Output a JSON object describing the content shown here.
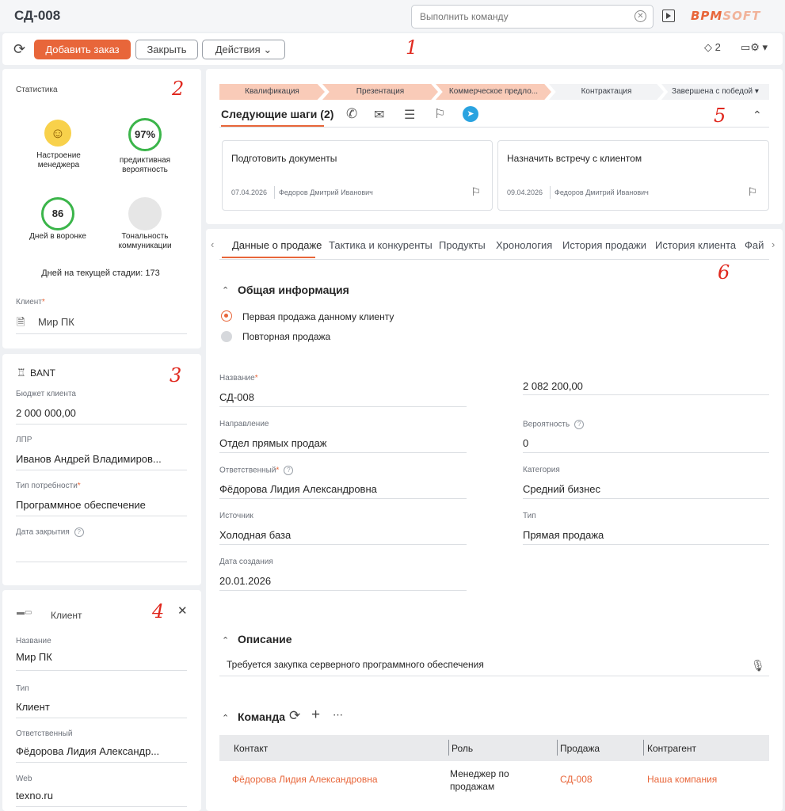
{
  "header": {
    "title": "СД-008",
    "command_placeholder": "Выполнить команду",
    "logo_part1": "BPM",
    "logo_part2": "SOFT"
  },
  "toolbar": {
    "add_label": "Добавить заказ",
    "close_label": "Закрыть",
    "actions_label": "Действия",
    "tag_count": "2"
  },
  "markers": [
    "1",
    "2",
    "3",
    "4",
    "5",
    "6"
  ],
  "stats": {
    "title": "Статистика",
    "mood_label": "Настроение менеджера",
    "probability_value": "97%",
    "probability_label": "предиктивная вероятность",
    "days_value": "86",
    "days_label": "Дней в воронке",
    "tone_label": "Тональность коммуникации",
    "stage_days": "Дней на текущей стадии: 173",
    "client_label": "Клиент",
    "client_value": "Мир ПК"
  },
  "bant": {
    "title": "BANT",
    "budget_label": "Бюджет клиента",
    "budget_value": "2 000 000,00",
    "lpr_label": "ЛПР",
    "lpr_value": "Иванов Андрей Владимиров...",
    "need_label": "Тип потребности",
    "need_value": "Программное обеспечение",
    "close_date_label": "Дата закрытия"
  },
  "client_card": {
    "title": "Клиент",
    "name_label": "Название",
    "name_value": "Мир ПК",
    "type_label": "Тип",
    "type_value": "Клиент",
    "owner_label": "Ответственный",
    "owner_value": "Фёдорова Лидия Александр...",
    "web_label": "Web",
    "web_value": "texno.ru"
  },
  "stages": [
    {
      "label": "Квалификация",
      "done": true
    },
    {
      "label": "Презентация",
      "done": true
    },
    {
      "label": "Коммерческое предло...",
      "done": true
    },
    {
      "label": "Контрактация",
      "done": false
    },
    {
      "label": "Завершена с победой",
      "done": false
    }
  ],
  "next_steps": {
    "title": "Следующие шаги (2)",
    "tasks": [
      {
        "title": "Подготовить документы",
        "date": "07.04.2026",
        "person": "Федоров Дмитрий Иванович"
      },
      {
        "title": "Назначить встречу с клиентом",
        "date": "09.04.2026",
        "person": "Федоров Дмитрий Иванович"
      }
    ]
  },
  "tabs": [
    "Данные о продаже",
    "Тактика и конкуренты",
    "Продукты",
    "Хронология",
    "История продажи",
    "История клиента",
    "Фай"
  ],
  "general": {
    "section_title": "Общая информация",
    "radio_first": "Первая продажа данному клиенту",
    "radio_repeat": "Повторная продажа",
    "name_label": "Название",
    "name_value": "СД-008",
    "amount_value": "2 082 200,00",
    "direction_label": "Направление",
    "direction_value": "Отдел прямых продаж",
    "probability_label": "Вероятность",
    "probability_value": "0",
    "owner_label": "Ответственный",
    "owner_value": "Фёдорова Лидия Александровна",
    "category_label": "Категория",
    "category_value": "Средний бизнес",
    "source_label": "Источник",
    "source_value": "Холодная база",
    "type_label": "Тип",
    "type_value": "Прямая продажа",
    "created_label": "Дата создания",
    "created_value": "20.01.2026"
  },
  "description": {
    "section_title": "Описание",
    "text": "Требуется закупка серверного программного обеспечения"
  },
  "team": {
    "section_title": "Команда",
    "columns": [
      "Контакт",
      "Роль",
      "Продажа",
      "Контрагент"
    ],
    "rows": [
      {
        "contact": "Фёдорова Лидия Александровна",
        "role_line1": "Менеджер по",
        "role_line2": "продажам",
        "sale": "СД-008",
        "counterparty": "Наша компания"
      }
    ]
  },
  "colors": {
    "accent": "#e8663a",
    "success": "#3bb54a",
    "marker": "#e0281e"
  }
}
